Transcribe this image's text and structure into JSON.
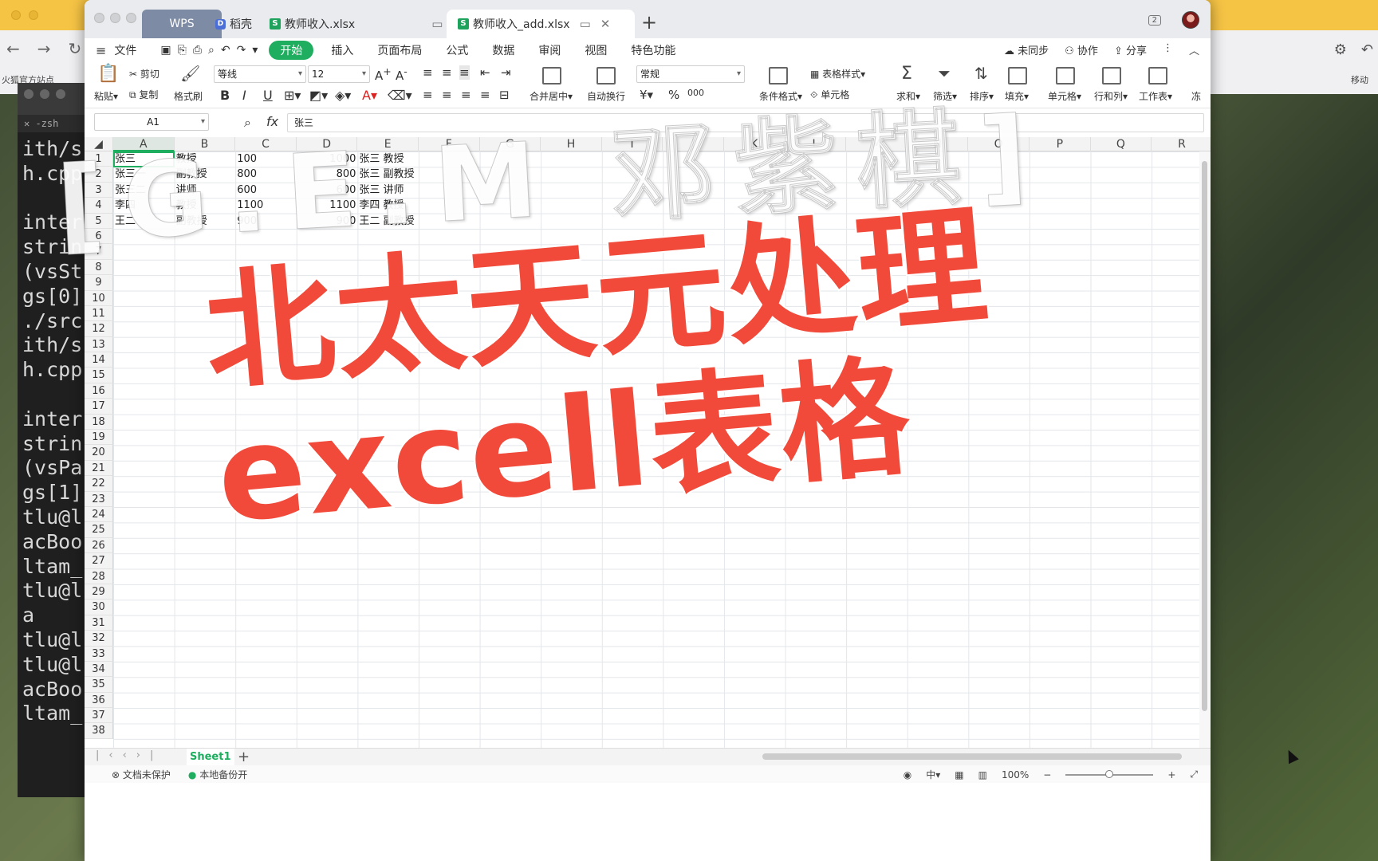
{
  "background": {
    "browser_bookmark": "火狐官方站点",
    "browser_bookmark_right": "移动",
    "terminal_tab": "-zsh",
    "terminal_lines": [
      "ith/s",
      "h.cpp",
      "",
      "inter",
      "strin",
      "(vsSt",
      "gs[0]",
      "./src",
      "ith/s",
      "h.cpp",
      "",
      "inter",
      "strin",
      "(vsPa",
      "gs[1]",
      "tlu@l",
      "acBoo",
      "ltam_",
      "tlu@l",
      "a",
      "tlu@l",
      "tlu@l",
      "acBoo",
      "ltam_"
    ]
  },
  "window": {
    "tabs": {
      "wps": "WPS",
      "docer": "稻壳",
      "file1": "教师收入.xlsx",
      "file2": "教师收入_add.xlsx"
    },
    "menu": {
      "file": "文件",
      "start": "开始",
      "items": [
        "插入",
        "页面布局",
        "公式",
        "数据",
        "审阅",
        "视图",
        "特色功能"
      ],
      "right": [
        "未同步",
        "协作",
        "分享"
      ]
    },
    "toolbar": {
      "paste": "粘贴",
      "cut": "剪切",
      "copy": "复制",
      "format_painter": "格式刷",
      "font_name": "等线",
      "font_size": "12",
      "merge_center": "合并居中",
      "wrap_text": "自动换行",
      "number_format": "常规",
      "cond_format": "条件格式",
      "table_style": "表格样式",
      "cell_style": "单元格",
      "sum": "求和",
      "filter": "筛选",
      "sort": "排序",
      "fill": "填充",
      "cell": "单元格",
      "row_col": "行和列",
      "worksheet": "工作表",
      "freeze": "冻"
    },
    "formula_bar": {
      "name_box": "A1",
      "fx": "fx",
      "content": "张三"
    }
  },
  "sheet": {
    "columns": [
      "A",
      "B",
      "C",
      "D",
      "E",
      "F",
      "G",
      "H",
      "I",
      "J",
      "K",
      "L",
      "M",
      "N",
      "O",
      "P",
      "Q",
      "R"
    ],
    "rows": [
      "1",
      "2",
      "3",
      "4",
      "5",
      "6",
      "7",
      "8",
      "9",
      "10",
      "11",
      "12",
      "13",
      "14",
      "15",
      "16",
      "17",
      "18",
      "19",
      "20",
      "21",
      "22",
      "23",
      "24",
      "25",
      "26",
      "27",
      "28",
      "29",
      "30",
      "31",
      "32",
      "33",
      "34",
      "35",
      "36",
      "37",
      "38"
    ],
    "data": [
      {
        "a": "张三",
        "b": "教授",
        "c": "100",
        "d": "1000",
        "e": "张三 教授"
      },
      {
        "a": "张三一",
        "b": "副教授",
        "c": "800",
        "d": "800",
        "e": "张三 副教授"
      },
      {
        "a": "张三二",
        "b": "讲师",
        "c": "600",
        "d": "600",
        "e": "张三 讲师"
      },
      {
        "a": "李四",
        "b": "教授",
        "c": "1100",
        "d": "1100",
        "e": "李四 教授"
      },
      {
        "a": "王二",
        "b": "副教授",
        "c": "900",
        "d": "900",
        "e": "王二 副教授"
      }
    ],
    "sheet_tab": "Sheet1",
    "status_left": [
      "文档未保护",
      "本地备份开"
    ],
    "zoom": "100%"
  },
  "overlay": {
    "watermark": "[G.E.M 邓紫棋]",
    "headline_line1": "北太天元处理",
    "headline_line2": "excell表格"
  }
}
